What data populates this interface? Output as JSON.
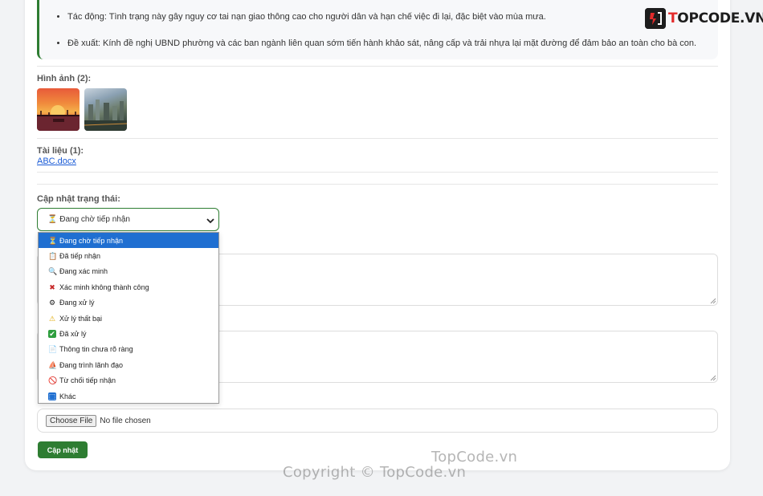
{
  "report": {
    "items": [
      "Tác động: Tình trạng này gây nguy cơ tai nạn giao thông cao cho người dân và hạn chế việc đi lại, đặc biệt vào mùa mưa.",
      "Đề xuất: Kính đề nghị UBND phường và các ban ngành liên quan sớm tiến hành khảo sát, nâng cấp và trải nhựa lại mặt đường để đảm bảo an toàn cho bà con."
    ]
  },
  "images": {
    "label": "Hình ảnh (2):"
  },
  "documents": {
    "label": "Tài liệu (1):",
    "file_name": "ABC.docx"
  },
  "status": {
    "label": "Cập nhật trạng thái:",
    "selected": "⏳ Đang chờ tiếp nhận",
    "options": [
      {
        "icon": "⏳",
        "text": "Đang chờ tiếp nhận",
        "icon_name": "hourglass-icon"
      },
      {
        "icon": "📋",
        "text": "Đã tiếp nhận",
        "icon_name": "clipboard-icon"
      },
      {
        "icon": "🔍",
        "text": "Đang xác minh",
        "icon_name": "magnifier-icon"
      },
      {
        "icon": "✖",
        "text": "Xác minh không thành công",
        "icon_name": "cross-icon"
      },
      {
        "icon": "⚙",
        "text": "Đang xử lý",
        "icon_name": "gear-icon"
      },
      {
        "icon": "⚠",
        "text": "Xử lý thất bại",
        "icon_name": "warning-icon"
      },
      {
        "icon": "✔",
        "text": "Đã xử lý",
        "icon_name": "check-icon"
      },
      {
        "icon": "📄",
        "text": "Thông tin chưa rõ ràng",
        "icon_name": "document-icon"
      },
      {
        "icon": "⛵",
        "text": "Đang trình lãnh đạo",
        "icon_name": "boat-icon"
      },
      {
        "icon": "🚫",
        "text": "Từ chối tiếp nhận",
        "icon_name": "prohibited-icon"
      },
      {
        "icon": "⬚",
        "text": "Khác",
        "icon_name": "other-icon"
      }
    ]
  },
  "file_input": {
    "button_label": "Choose File",
    "status": "No file chosen"
  },
  "submit_label": "Cập nhật",
  "logo_text": "TOPCODE.VN",
  "watermark": {
    "brand": "TopCode.vn",
    "copyright": "Copyright © TopCode.vn"
  },
  "colors": {
    "accent": "#2e7d32",
    "selection": "#1f6fd1",
    "link": "#1a5bd6"
  }
}
